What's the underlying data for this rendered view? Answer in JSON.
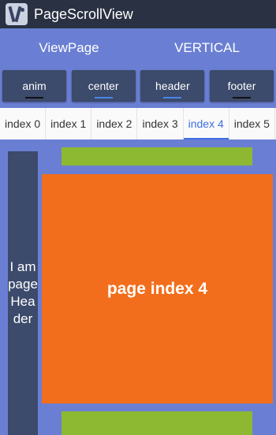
{
  "app": {
    "title": "PageScrollView"
  },
  "top_buttons": [
    {
      "label": "ViewPage"
    },
    {
      "label": "VERTICAL"
    }
  ],
  "modes": [
    {
      "label": "anim",
      "indicator_color": "#111111"
    },
    {
      "label": "center",
      "indicator_color": "#4A86E8"
    },
    {
      "label": "header",
      "indicator_color": "#4A86E8"
    },
    {
      "label": "footer",
      "indicator_color": "#111111"
    }
  ],
  "tabs": {
    "items": [
      "index 0",
      "index 1",
      "index 2",
      "index 3",
      "index 4",
      "index 5"
    ],
    "active_index": 4
  },
  "page": {
    "header_text": "I am page Header",
    "main_label": "page index 4"
  },
  "colors": {
    "background": "#6A7FD3",
    "titlebar": "#2A3142",
    "mode_button": "#3C4A6B",
    "page_main": "#F26E1C",
    "bars": "#8DB832",
    "tab_active": "#3F6FE0"
  }
}
